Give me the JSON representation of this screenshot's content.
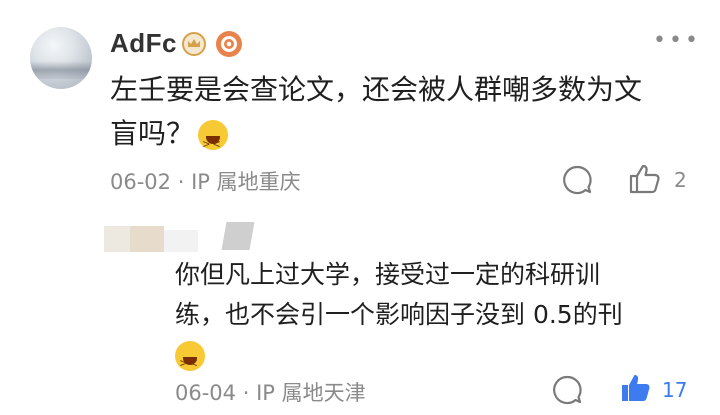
{
  "comment": {
    "username": "AdFc",
    "text_line1": "左壬要是会查论文，还会被人群嘲多数为文",
    "text_line2": "盲吗？",
    "date": "06-02",
    "separator": "·",
    "ip_location": "IP 属地重庆",
    "likes": "2"
  },
  "reply": {
    "text_line1": "你但凡上过大学，接受过一定的科研训",
    "text_line2": "练，也不会引一个影响因子没到 0.5的刊",
    "date": "06-04",
    "separator": "·",
    "ip_location": "IP 属地天津",
    "likes": "17",
    "liked": true
  },
  "colors": {
    "liked_blue": "#3c7cf0",
    "meta_gray": "#8a8a8a",
    "badge_orange": "#e8834b",
    "badge_gold": "#d4a24a"
  },
  "icons": [
    "more-icon",
    "crown-badge-icon",
    "eye-badge-icon",
    "comment-icon",
    "thumbs-up-icon",
    "laughing-emoji-icon"
  ]
}
